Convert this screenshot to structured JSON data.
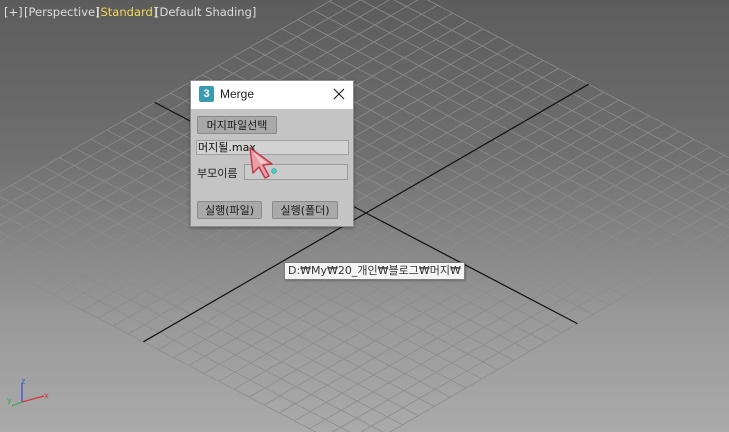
{
  "viewport": {
    "label_plus": "[+]",
    "label_perspective": "[Perspective]",
    "label_standard_open": "[",
    "label_standard": "Standard",
    "label_standard_close": "]",
    "label_shading": "[Default Shading]",
    "highlight_color": "#f2d95a"
  },
  "dialog": {
    "icon_text": "3",
    "title": "Merge",
    "select_file_button": "머지파일선택",
    "file_field_value": "머지될.max",
    "parent_name_label": "부모이름",
    "parent_name_value": "",
    "run_file_button": "실행(파일)",
    "run_folder_button": "실행(폴더)"
  },
  "tooltip": {
    "text": "D:₩My₩20_개인₩블로그₩머지₩"
  },
  "gizmo": {
    "x_label": "x",
    "y_label": "y",
    "z_label": "z"
  }
}
